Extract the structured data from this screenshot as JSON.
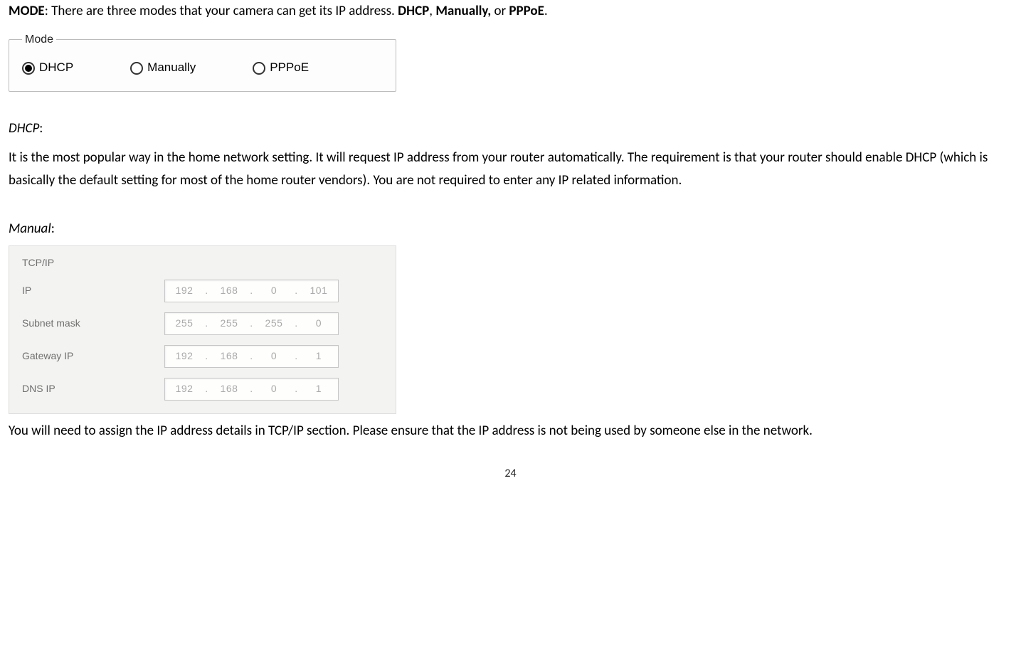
{
  "intro": {
    "mode_label": "MODE",
    "intro_text_1": ": There are three modes that your camera can get its IP address. ",
    "b1": "DHCP",
    "sep1": ", ",
    "b2": "Manually,",
    "sep2": " or ",
    "b3": "PPPoE",
    "end": "."
  },
  "mode_box": {
    "legend": "Mode",
    "options": {
      "dhcp": "DHCP",
      "manually": "Manually",
      "pppoe": "PPPoE"
    }
  },
  "dhcp_section": {
    "heading": "DHCP",
    "colon": ":",
    "body": "It is the most popular way in the home network setting. It will request IP address from your router automatically. The requirement is that your router should enable DHCP (which is basically the default setting for most of the home router vendors). You are not required to enter any IP related information."
  },
  "manual_section": {
    "heading": "Manual",
    "colon": ":"
  },
  "tcpip": {
    "title": "TCP/IP",
    "rows": [
      {
        "label": "IP",
        "segs": [
          "192",
          "168",
          "0",
          "101"
        ]
      },
      {
        "label": "Subnet mask",
        "segs": [
          "255",
          "255",
          "255",
          "0"
        ]
      },
      {
        "label": "Gateway IP",
        "segs": [
          "192",
          "168",
          "0",
          "1"
        ]
      },
      {
        "label": "DNS IP",
        "segs": [
          "192",
          "168",
          "0",
          "1"
        ]
      }
    ]
  },
  "post_tcpip": "You will need to assign the IP address details in TCP/IP section. Please ensure that the IP address is not being used by someone else in the network.",
  "page_number": "24"
}
